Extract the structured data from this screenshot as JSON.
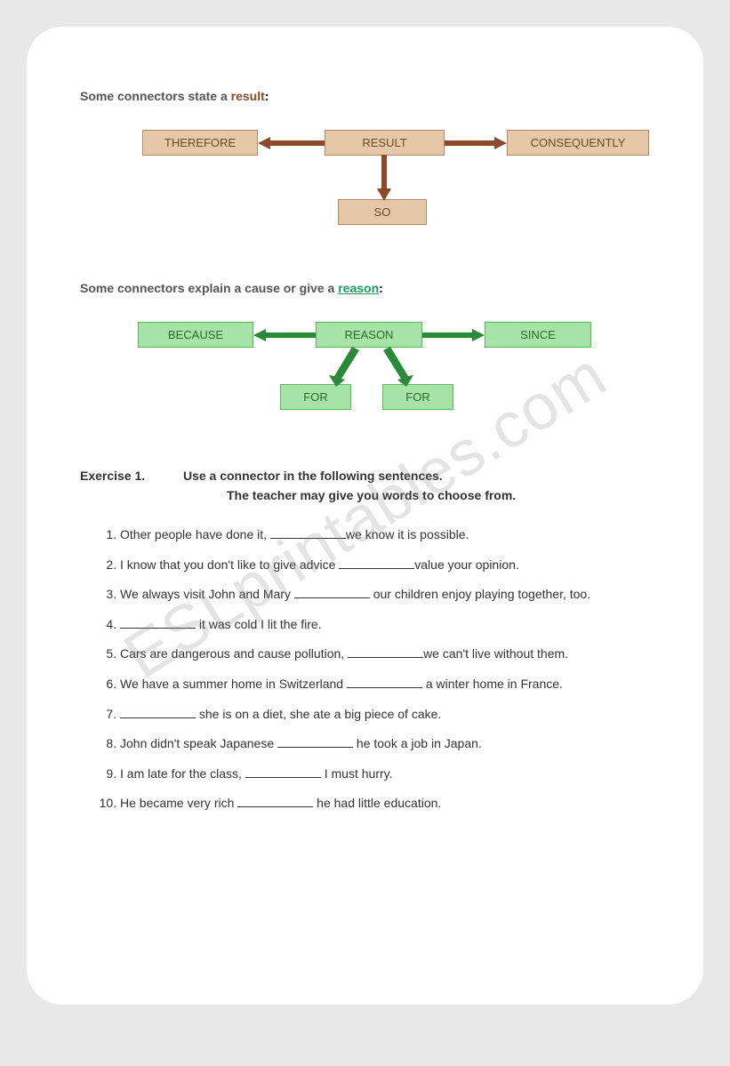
{
  "watermark": "ESLprintables.com",
  "section1": {
    "intro_prefix": "Some connectors state a ",
    "intro_keyword": "result",
    "intro_suffix": ":",
    "center": "RESULT",
    "left": "THEREFORE",
    "right": "CONSEQUENTLY",
    "bottom": "SO"
  },
  "section2": {
    "intro_prefix": "Some connectors explain a cause or give a ",
    "intro_keyword": "reason",
    "intro_suffix": ":",
    "center": "REASON",
    "left": "BECAUSE",
    "right": "SINCE",
    "bottom_left": "FOR",
    "bottom_right": "FOR"
  },
  "exercise": {
    "title": "Exercise 1.",
    "instruction1": "Use a connector in the following sentences.",
    "instruction2": "The teacher may give you words to choose from.",
    "items": [
      {
        "pre": "Other people have done it,",
        "post": "we know it is possible."
      },
      {
        "pre": "I know that you don't like to give advice",
        "post": "value your opinion."
      },
      {
        "pre": "We always visit John and Mary",
        "post": "our children enjoy playing together, too."
      },
      {
        "pre": "",
        "post": "it was cold I lit the fire."
      },
      {
        "pre": "Cars are dangerous and cause pollution,",
        "post": "we can't live without them."
      },
      {
        "pre": "We have a summer home in Switzerland",
        "post": "a winter home in France."
      },
      {
        "pre": "",
        "post": "she is on a diet, she ate a big piece of cake."
      },
      {
        "pre": "John didn't speak Japanese",
        "post": "he took a job in Japan."
      },
      {
        "pre": "I am late for the class,",
        "post": "I must hurry."
      },
      {
        "pre": "He became very rich",
        "post": "he had little education."
      }
    ]
  }
}
